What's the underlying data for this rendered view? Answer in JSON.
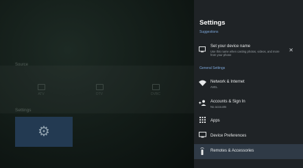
{
  "home": {
    "inputs_heading": "Source",
    "inputs": [
      {
        "label": "ATV"
      },
      {
        "label": "DTV"
      },
      {
        "label": "DVBC"
      }
    ],
    "settings_heading": "Settings"
  },
  "panel": {
    "title": "Settings",
    "suggestions_heading": "Suggestions",
    "suggestion": {
      "label": "Set your device name",
      "description": "Use this name when casting photos, videos, and more from your phone",
      "icon": "cast-screen-icon"
    },
    "general_heading": "General Settings",
    "items": [
      {
        "label": "Network & Internet",
        "sub": "AVEL",
        "icon": "wifi-icon"
      },
      {
        "label": "Accounts & Sign In",
        "sub": "No accounts",
        "icon": "person-add-icon"
      },
      {
        "label": "Apps",
        "sub": "",
        "icon": "apps-grid-icon"
      },
      {
        "label": "Device Preferences",
        "sub": "",
        "icon": "tv-icon"
      },
      {
        "label": "Remotes & Accessories",
        "sub": "",
        "icon": "remote-icon"
      }
    ]
  }
}
